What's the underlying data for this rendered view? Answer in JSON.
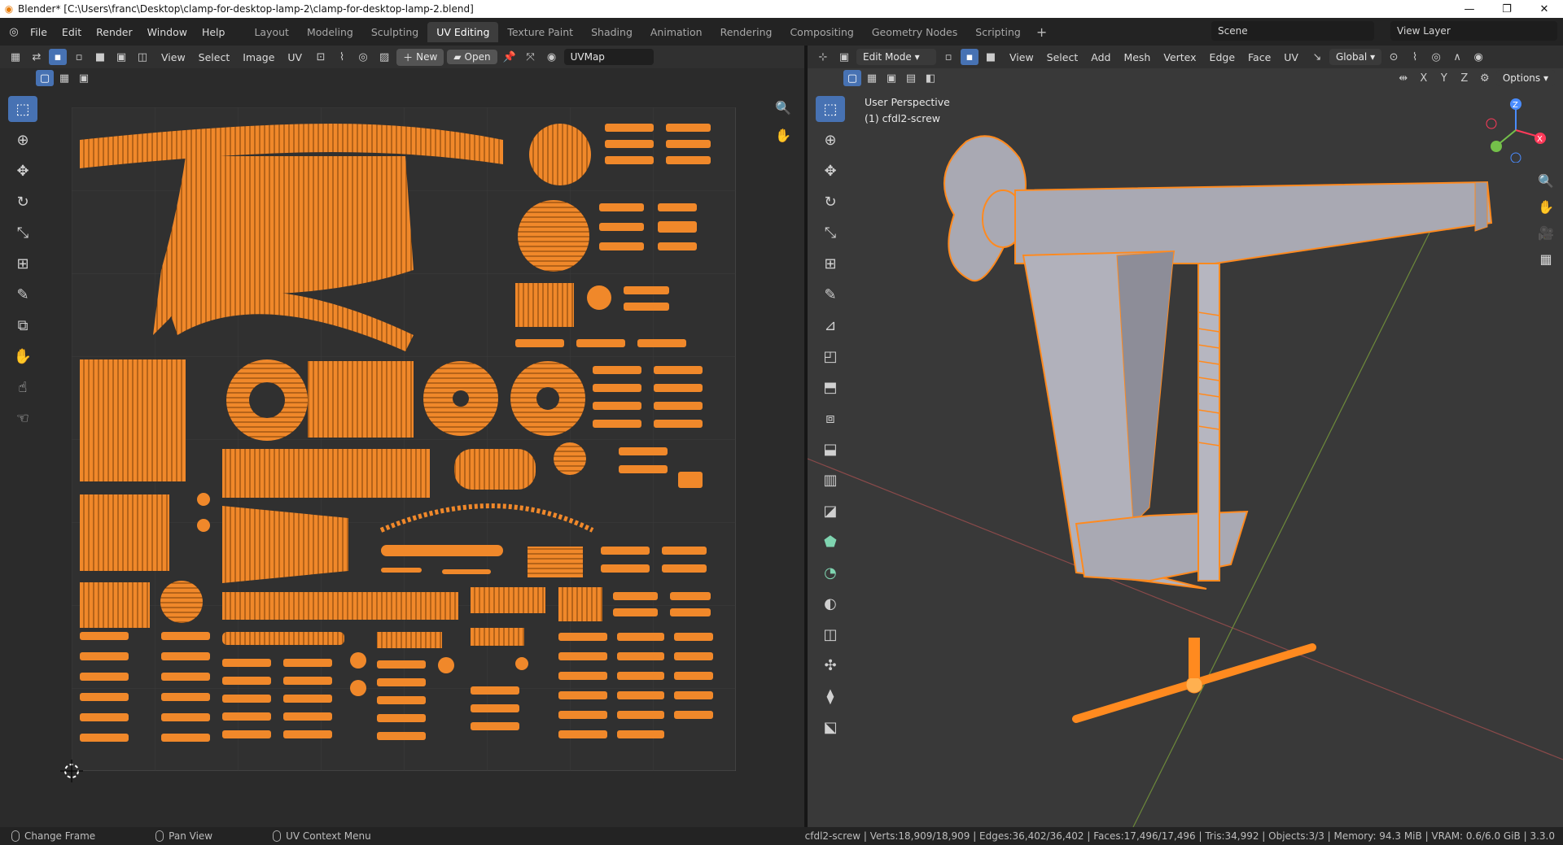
{
  "window": {
    "title": "Blender* [C:\\Users\\franc\\Desktop\\clamp-for-desktop-lamp-2\\clamp-for-desktop-lamp-2.blend]"
  },
  "menu": [
    "File",
    "Edit",
    "Render",
    "Window",
    "Help"
  ],
  "workspaces": [
    "Layout",
    "Modeling",
    "Sculpting",
    "UV Editing",
    "Texture Paint",
    "Shading",
    "Animation",
    "Rendering",
    "Compositing",
    "Geometry Nodes",
    "Scripting"
  ],
  "active_workspace": "UV Editing",
  "scene": {
    "label": "Scene"
  },
  "view_layer": {
    "label": "View Layer"
  },
  "uv_editor": {
    "menus": [
      "View",
      "Select",
      "Image",
      "UV"
    ],
    "new_label": "New",
    "open_label": "Open",
    "uvmap": "UVMap"
  },
  "viewport": {
    "mode": "Edit Mode",
    "menus": [
      "View",
      "Select",
      "Add",
      "Mesh",
      "Vertex",
      "Edge",
      "Face",
      "UV"
    ],
    "orientation": "Global",
    "options_label": "Options",
    "axes": [
      "X",
      "Y",
      "Z"
    ],
    "perspective": "User Perspective",
    "object": "(1) cfdl2-screw"
  },
  "status": {
    "items": [
      "Change Frame",
      "Pan View",
      "UV Context Menu"
    ],
    "stats": "cfdl2-screw | Verts:18,909/18,909 | Edges:36,402/36,402 | Faces:17,496/17,496 | Tris:34,992 | Objects:3/3 | Memory: 94.3 MiB | VRAM: 0.6/6.0 GiB | 3.3.0"
  },
  "colors": {
    "accent": "#4772b3",
    "uv": "#f0882a",
    "mesh": "#ff8a1f",
    "bg": "#2b2b2b"
  },
  "icons": [
    "blender-logo",
    "select-box-icon",
    "cursor-icon",
    "move-icon",
    "rotate-icon",
    "scale-icon",
    "transform-icon",
    "annotate-icon",
    "hand-icon",
    "zoom-icon",
    "camera-icon",
    "grid-icon"
  ]
}
